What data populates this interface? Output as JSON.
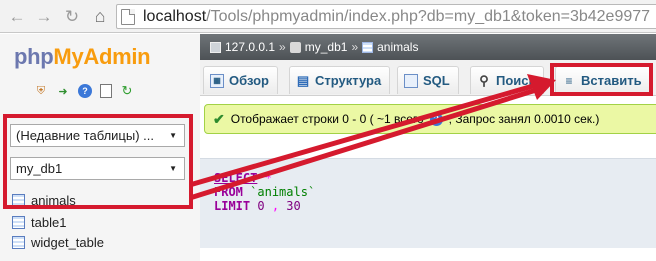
{
  "browser": {
    "url_host": "localhost",
    "url_path": "/Tools/phpmyadmin/index.php?db=my_db1&token=3b42e9977"
  },
  "logo": {
    "part1": "php",
    "part2": "MyAdmin"
  },
  "left_panel": {
    "recent_select": "(Недавние таблицы) ...",
    "db_select": "my_db1",
    "tables": [
      "animals",
      "table1",
      "widget_table"
    ]
  },
  "breadcrumb": {
    "server": "127.0.0.1",
    "database": "my_db1",
    "table": "animals",
    "separator": "»"
  },
  "tabs": [
    {
      "label": "Обзор",
      "icon": "browse-icon"
    },
    {
      "label": "Структура",
      "icon": "structure-icon"
    },
    {
      "label": "SQL",
      "icon": "sql-icon"
    },
    {
      "label": "Поиск",
      "icon": "search-icon"
    },
    {
      "label": "Вставить",
      "icon": "insert-icon"
    }
  ],
  "message": {
    "text_before": "Отображает строки 0 - 0 ( ~1 всего",
    "text_after": ", Запрос занял 0.0010 сек.)"
  },
  "sql": {
    "select_kw": "SELECT",
    "star": "*",
    "from_kw": "FROM",
    "table": "`animals`",
    "limit_kw": "LIMIT",
    "offset": "0",
    "comma": ",",
    "count": "30"
  },
  "annotation_color": "#d51a2e"
}
